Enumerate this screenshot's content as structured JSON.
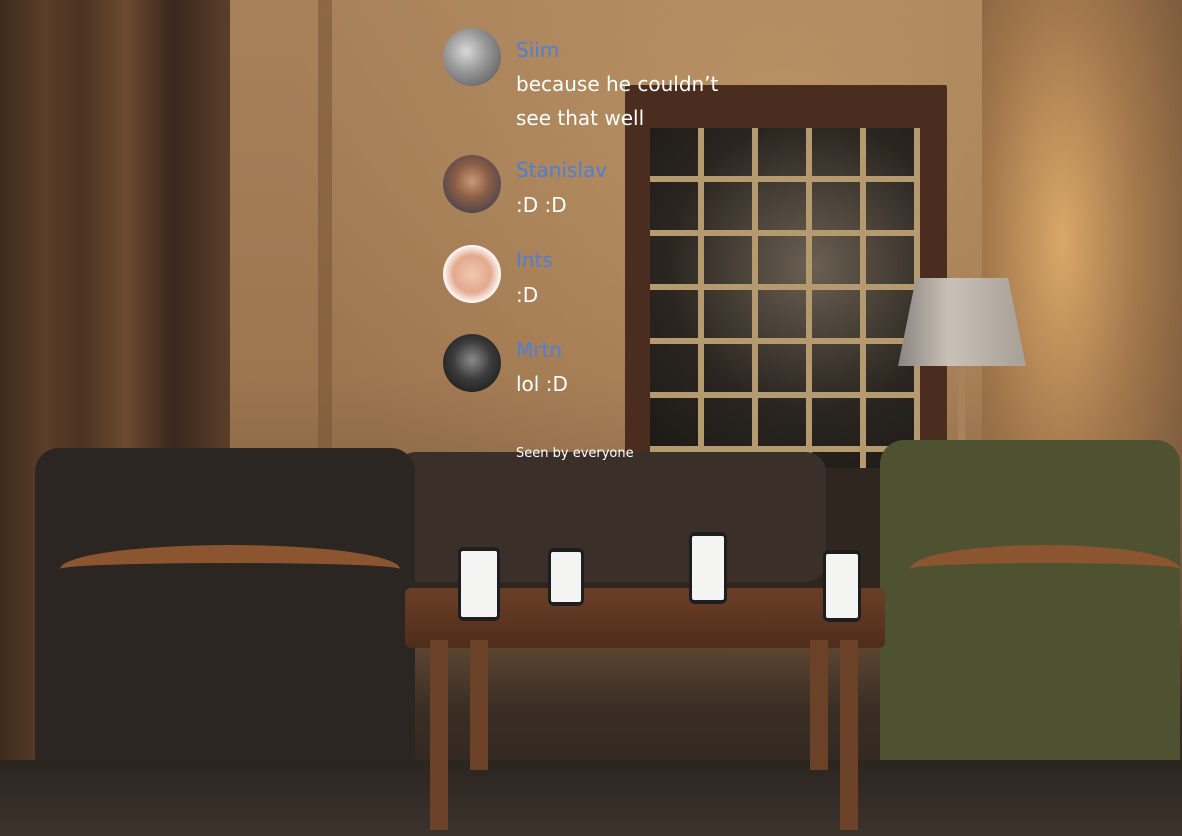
{
  "messages": [
    {
      "name": "Siim",
      "lines": [
        "because he couldn’t",
        "see that well"
      ],
      "avatar_icon": "avatar-siim"
    },
    {
      "name": "Stanislav",
      "lines": [
        ":D :D"
      ],
      "avatar_icon": "avatar-stanislav"
    },
    {
      "name": "Ints",
      "lines": [
        ":D"
      ],
      "avatar_icon": "avatar-ints"
    },
    {
      "name": "Mrtn",
      "lines": [
        "lol :D"
      ],
      "avatar_icon": "avatar-mrtn"
    }
  ],
  "status": {
    "seen": "Seen by everyone"
  },
  "colors": {
    "name": "#4d7fd6",
    "text": "#ffffff"
  }
}
